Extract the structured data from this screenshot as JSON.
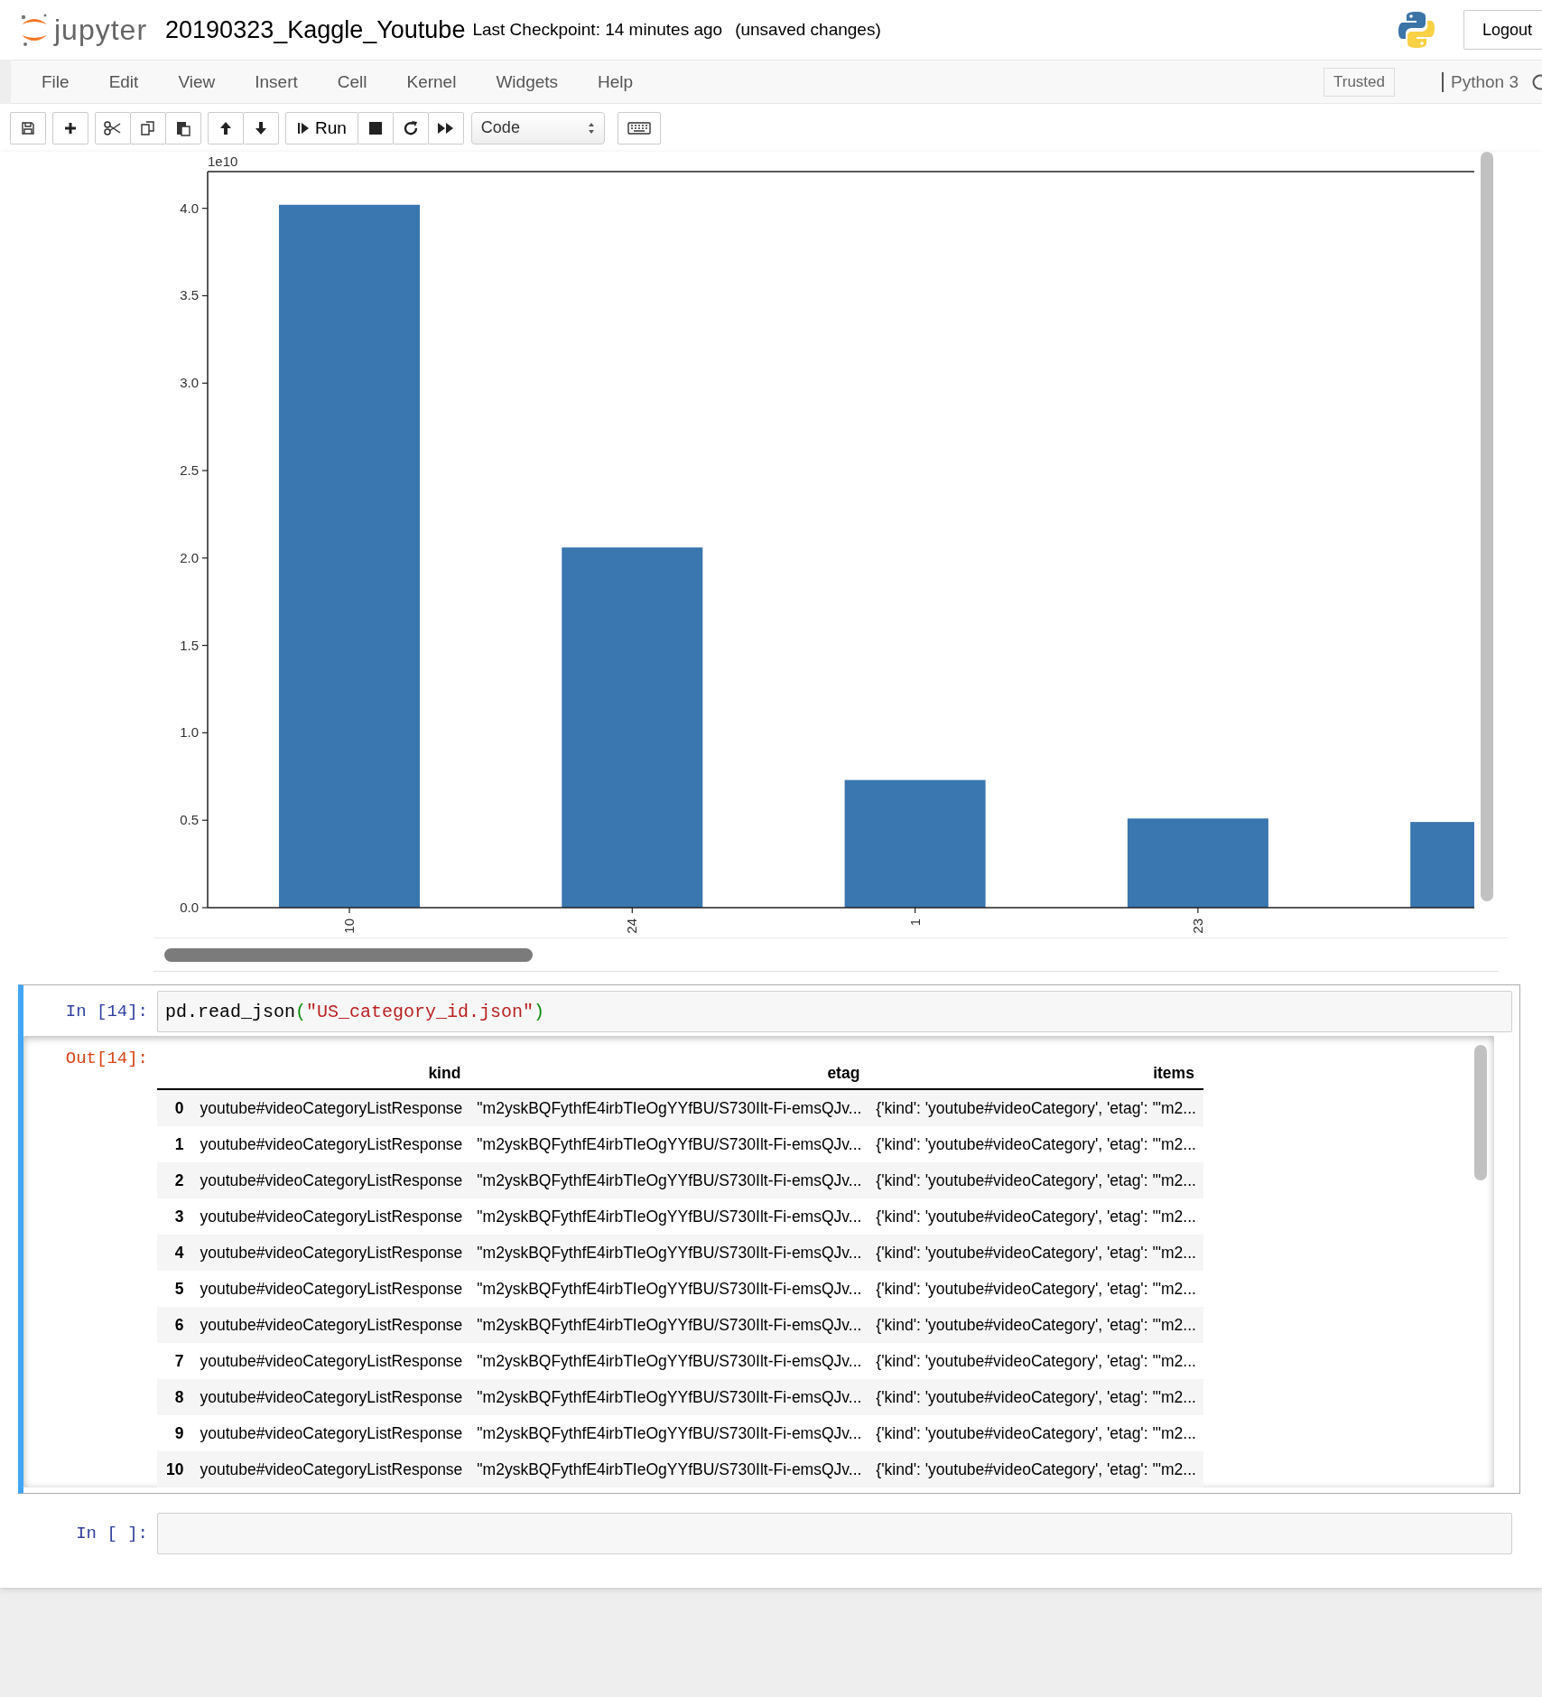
{
  "header": {
    "logo_text": "jupyter",
    "notebook_name": "20190323_Kaggle_Youtube",
    "checkpoint": "Last Checkpoint: 14 minutes ago",
    "save_status": "(unsaved changes)",
    "logout": "Logout"
  },
  "menu": [
    "File",
    "Edit",
    "View",
    "Insert",
    "Cell",
    "Kernel",
    "Widgets",
    "Help"
  ],
  "status": {
    "trusted": "Trusted",
    "kernel": "Python 3"
  },
  "toolbar": {
    "run_label": "Run",
    "cell_type": "Code"
  },
  "chart_cell": {
    "offset_text": "1e10",
    "chart_data": {
      "type": "bar",
      "categories": [
        "10",
        "24",
        "1",
        "23",
        null
      ],
      "values": [
        4.02,
        2.06,
        0.73,
        0.51,
        0.49
      ],
      "ylim": [
        0,
        4.21
      ],
      "yticks": [
        {
          "value": 0,
          "label": "0.0"
        },
        {
          "value": 0.5,
          "label": "0.5"
        },
        {
          "value": 1,
          "label": "1.0"
        },
        {
          "value": 1.5,
          "label": "1.5"
        },
        {
          "value": 2,
          "label": "2.0"
        },
        {
          "value": 2.5,
          "label": "2.5"
        },
        {
          "value": 3,
          "label": "3.0"
        },
        {
          "value": 3.5,
          "label": "3.5"
        },
        {
          "value": 4,
          "label": "4.0"
        }
      ]
    }
  },
  "cells": [
    {
      "selected": true,
      "prompt": "In [14]:",
      "code": [
        {
          "kind": "plain",
          "text": "pd.read_json"
        },
        {
          "kind": "paren",
          "text": "("
        },
        {
          "kind": "string",
          "text": "\"US_category_id.json\""
        },
        {
          "kind": "paren",
          "text": ")"
        }
      ],
      "output_prompt": "Out[14]:",
      "table": {
        "columns": [
          "kind",
          "etag",
          "items"
        ],
        "rows": [
          {
            "index": "0",
            "kind": "youtube#videoCategoryListResponse",
            "etag": "\"m2yskBQFythfE4irbTIeOgYYfBU/S730Ilt-Fi-emsQJv...",
            "items": "{'kind': 'youtube#videoCategory', 'etag': '\"m2..."
          },
          {
            "index": "1",
            "kind": "youtube#videoCategoryListResponse",
            "etag": "\"m2yskBQFythfE4irbTIeOgYYfBU/S730Ilt-Fi-emsQJv...",
            "items": "{'kind': 'youtube#videoCategory', 'etag': '\"m2..."
          },
          {
            "index": "2",
            "kind": "youtube#videoCategoryListResponse",
            "etag": "\"m2yskBQFythfE4irbTIeOgYYfBU/S730Ilt-Fi-emsQJv...",
            "items": "{'kind': 'youtube#videoCategory', 'etag': '\"m2..."
          },
          {
            "index": "3",
            "kind": "youtube#videoCategoryListResponse",
            "etag": "\"m2yskBQFythfE4irbTIeOgYYfBU/S730Ilt-Fi-emsQJv...",
            "items": "{'kind': 'youtube#videoCategory', 'etag': '\"m2..."
          },
          {
            "index": "4",
            "kind": "youtube#videoCategoryListResponse",
            "etag": "\"m2yskBQFythfE4irbTIeOgYYfBU/S730Ilt-Fi-emsQJv...",
            "items": "{'kind': 'youtube#videoCategory', 'etag': '\"m2..."
          },
          {
            "index": "5",
            "kind": "youtube#videoCategoryListResponse",
            "etag": "\"m2yskBQFythfE4irbTIeOgYYfBU/S730Ilt-Fi-emsQJv...",
            "items": "{'kind': 'youtube#videoCategory', 'etag': '\"m2..."
          },
          {
            "index": "6",
            "kind": "youtube#videoCategoryListResponse",
            "etag": "\"m2yskBQFythfE4irbTIeOgYYfBU/S730Ilt-Fi-emsQJv...",
            "items": "{'kind': 'youtube#videoCategory', 'etag': '\"m2..."
          },
          {
            "index": "7",
            "kind": "youtube#videoCategoryListResponse",
            "etag": "\"m2yskBQFythfE4irbTIeOgYYfBU/S730Ilt-Fi-emsQJv...",
            "items": "{'kind': 'youtube#videoCategory', 'etag': '\"m2..."
          },
          {
            "index": "8",
            "kind": "youtube#videoCategoryListResponse",
            "etag": "\"m2yskBQFythfE4irbTIeOgYYfBU/S730Ilt-Fi-emsQJv...",
            "items": "{'kind': 'youtube#videoCategory', 'etag': '\"m2..."
          },
          {
            "index": "9",
            "kind": "youtube#videoCategoryListResponse",
            "etag": "\"m2yskBQFythfE4irbTIeOgYYfBU/S730Ilt-Fi-emsQJv...",
            "items": "{'kind': 'youtube#videoCategory', 'etag': '\"m2..."
          },
          {
            "index": "10",
            "kind": "youtube#videoCategoryListResponse",
            "etag": "\"m2yskBQFythfE4irbTIeOgYYfBU/S730Ilt-Fi-emsQJv...",
            "items": "{'kind': 'youtube#videoCategory', 'etag': '\"m2..."
          }
        ]
      }
    },
    {
      "selected": false,
      "prompt": "In [ ]:"
    }
  ]
}
